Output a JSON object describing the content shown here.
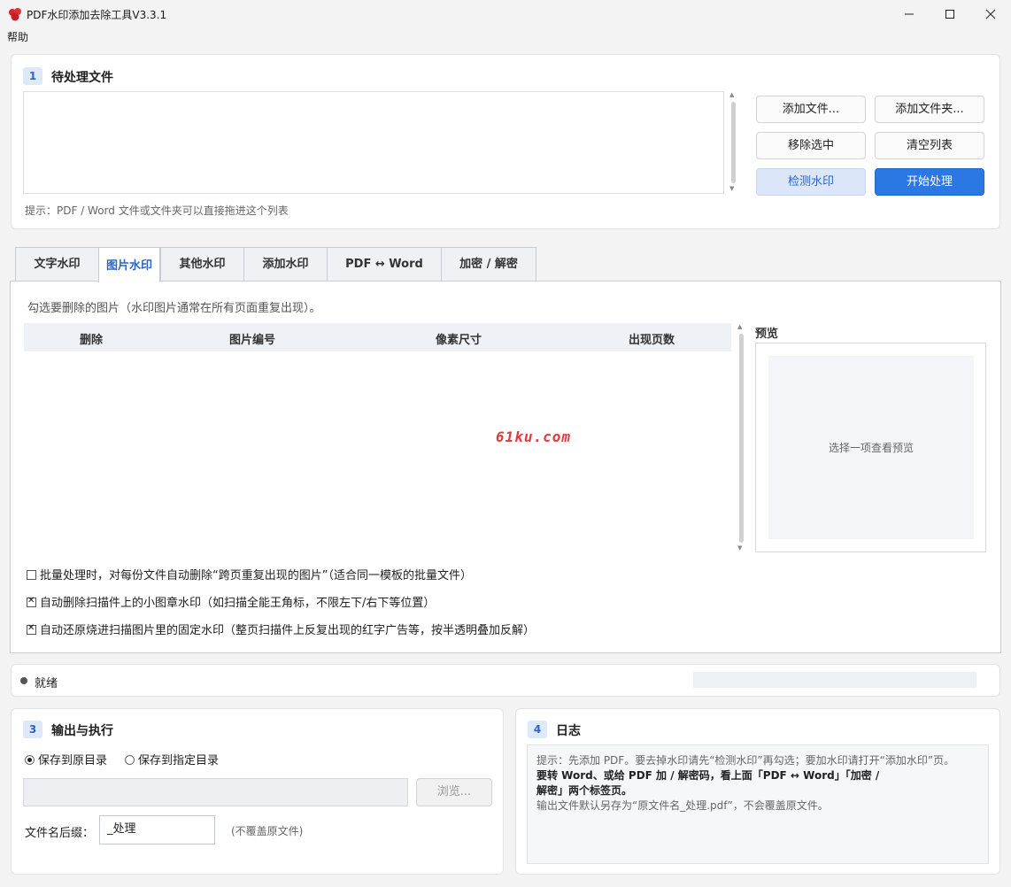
{
  "window": {
    "title": "PDF水印添加去除工具V3.3.1"
  },
  "menu": {
    "help": "帮助"
  },
  "section1": {
    "num": "1",
    "title": "待处理文件",
    "hint": "提示：PDF / Word 文件或文件夹可以直接拖进这个列表",
    "buttons": {
      "add_file": "添加文件...",
      "add_folder": "添加文件夹...",
      "remove_selected": "移除选中",
      "clear_list": "清空列表",
      "detect": "检测水印",
      "start": "开始处理"
    }
  },
  "tabs": [
    {
      "label": "文字水印"
    },
    {
      "label": "图片水印"
    },
    {
      "label": "其他水印"
    },
    {
      "label": "添加水印"
    },
    {
      "label": "PDF ↔ Word"
    },
    {
      "label": "加密 / 解密"
    }
  ],
  "image_tab": {
    "desc": "勾选要删除的图片（水印图片通常在所有页面重复出现）。",
    "columns": [
      "删除",
      "图片编号",
      "像素尺寸",
      "出现页数"
    ],
    "preview_label": "预览",
    "preview_placeholder": "选择一项查看预览",
    "options": [
      {
        "label": "批量处理时，对每份文件自动删除“跨页重复出现的图片”（适合同一模板的批量文件）",
        "checked": false
      },
      {
        "label": "自动删除扫描件上的小图章水印（如扫描全能王角标，不限左下/右下等位置）",
        "checked": true
      },
      {
        "label": "自动还原烧进扫描图片里的固定水印（整页扫描件上反复出现的红字广告等，按半透明叠加反解）",
        "checked": true
      }
    ]
  },
  "status": {
    "text": "就绪"
  },
  "section3": {
    "num": "3",
    "title": "输出与执行",
    "radio_original": "保存到原目录",
    "radio_custom": "保存到指定目录",
    "browse": "浏览...",
    "suffix_label": "文件名后缀：",
    "suffix_value": "_处理",
    "suffix_note": "(不覆盖原文件)"
  },
  "section4": {
    "num": "4",
    "title": "日志",
    "log_line1": "提示：先添加 PDF。要去掉水印请先“检测水印”再勾选；要加水印请打开“添加水印”页。",
    "log_line2": "要转 Word、或给 PDF 加 / 解密码，看上面「PDF ↔ Word」「加密 /",
    "log_line3": "解密」两个标签页。",
    "log_line4": "输出文件默认另存为“原文件名_处理.pdf”，不会覆盖原文件。"
  },
  "overlay_watermark": "61ku.com",
  "colors": {
    "accent": "#2b78e4",
    "accent_text": "#2b66c3",
    "detect_bg": "#dbe7f8"
  }
}
